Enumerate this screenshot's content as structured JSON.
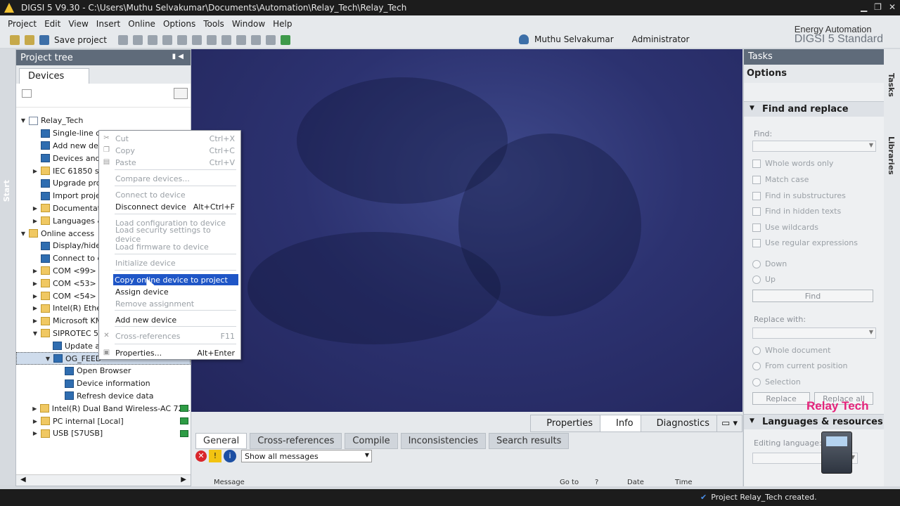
{
  "window": {
    "title": "DIGSI 5 V9.30  -  C:\\Users\\Muthu Selvakumar\\Documents\\Automation\\Relay_Tech\\Relay_Tech"
  },
  "menu": [
    "Project",
    "Edit",
    "View",
    "Insert",
    "Online",
    "Options",
    "Tools",
    "Window",
    "Help"
  ],
  "toolbar": {
    "save_label": "Save project"
  },
  "user": {
    "name": "Muthu Selvakumar",
    "role": "Administrator"
  },
  "brand": {
    "line1": "Energy Automation",
    "line2": "DIGSI 5 Standard"
  },
  "start_tab": "Start",
  "project_tree": {
    "title": "Project tree",
    "tab": "Devices",
    "rows": [
      {
        "label": "Relay_Tech",
        "arrow": "▼",
        "icon": "doc"
      },
      {
        "label": "Single-line co",
        "arrow": "",
        "icon": "blue"
      },
      {
        "label": "Add new dev",
        "arrow": "",
        "icon": "blue"
      },
      {
        "label": "Devices and",
        "arrow": "",
        "icon": "blue"
      },
      {
        "label": "IEC 61850 st",
        "arrow": "▶",
        "icon": "folder"
      },
      {
        "label": "Upgrade pro",
        "arrow": "",
        "icon": "blue"
      },
      {
        "label": "Import proje",
        "arrow": "",
        "icon": "blue"
      },
      {
        "label": "Documentat",
        "arrow": "▶",
        "icon": "folder"
      },
      {
        "label": "Languages &",
        "arrow": "▶",
        "icon": "folder"
      },
      {
        "label": "Online access",
        "arrow": "▼",
        "icon": "folder"
      },
      {
        "label": "Display/hide",
        "arrow": "",
        "icon": "blue"
      },
      {
        "label": "Connect to d",
        "arrow": "",
        "icon": "blue"
      },
      {
        "label": "COM <99>",
        "arrow": "▶",
        "icon": "folder"
      },
      {
        "label": "COM <53>",
        "arrow": "▶",
        "icon": "folder"
      },
      {
        "label": "COM <54>",
        "arrow": "▶",
        "icon": "folder"
      },
      {
        "label": "Intel(R) Ether",
        "arrow": "▶",
        "icon": "folder"
      },
      {
        "label": "Microsoft KM",
        "arrow": "▶",
        "icon": "folder"
      },
      {
        "label": "SIPROTEC 5 d",
        "arrow": "▼",
        "icon": "folder"
      },
      {
        "label": "Update a",
        "arrow": "",
        "icon": "blue"
      },
      {
        "label": "OG_FEED",
        "arrow": "▼",
        "icon": "blue"
      },
      {
        "label": "Open Browser",
        "arrow": "",
        "icon": "blue"
      },
      {
        "label": "Device information",
        "arrow": "",
        "icon": "blue"
      },
      {
        "label": "Refresh device data",
        "arrow": "",
        "icon": "blue"
      },
      {
        "label": "Intel(R) Dual Band Wireless-AC 72...",
        "arrow": "▶",
        "icon": "folder"
      },
      {
        "label": "PC internal [Local]",
        "arrow": "▶",
        "icon": "folder"
      },
      {
        "label": "USB [S7USB]",
        "arrow": "▶",
        "icon": "folder"
      }
    ]
  },
  "context_menu": {
    "items": [
      {
        "label": "Cut",
        "shortcut": "Ctrl+X",
        "disabled": true
      },
      {
        "label": "Copy",
        "shortcut": "Ctrl+C",
        "disabled": true
      },
      {
        "label": "Paste",
        "shortcut": "Ctrl+V",
        "disabled": true
      },
      {
        "label": "Compare devices...",
        "shortcut": "",
        "disabled": true
      },
      {
        "label": "Connect to device",
        "shortcut": "",
        "disabled": true
      },
      {
        "label": "Disconnect device",
        "shortcut": "Alt+Ctrl+F",
        "disabled": false
      },
      {
        "label": "Load configuration to device",
        "shortcut": "",
        "disabled": true
      },
      {
        "label": "Load security settings to device",
        "shortcut": "",
        "disabled": true
      },
      {
        "label": "Load firmware to device",
        "shortcut": "",
        "disabled": true
      },
      {
        "label": "Initialize device",
        "shortcut": "",
        "disabled": true
      },
      {
        "label": "Copy online device to project",
        "shortcut": "",
        "disabled": false,
        "highlighted": true
      },
      {
        "label": "Assign device",
        "shortcut": "",
        "disabled": false
      },
      {
        "label": "Remove assignment",
        "shortcut": "",
        "disabled": true
      },
      {
        "label": "Add new device",
        "shortcut": "",
        "disabled": false
      },
      {
        "label": "Cross-references",
        "shortcut": "F11",
        "disabled": true
      },
      {
        "label": "Properties...",
        "shortcut": "Alt+Enter",
        "disabled": false
      }
    ]
  },
  "inspector": {
    "tabs": [
      "Properties",
      "Info",
      "Diagnostics"
    ],
    "active_tab": "Info",
    "subtabs": [
      "General",
      "Cross-references",
      "Compile",
      "Inconsistencies",
      "Search results"
    ],
    "filter_value": "Show all messages",
    "columns": [
      "Message",
      "Go to",
      "?",
      "Date",
      "Time"
    ]
  },
  "tasks": {
    "title": "Tasks",
    "options_label": "Options",
    "find_replace_title": "Find and replace",
    "find_label": "Find:",
    "checkboxes": [
      "Whole words only",
      "Match case",
      "Find in substructures",
      "Find in hidden texts",
      "Use wildcards",
      "Use regular expressions"
    ],
    "direction": [
      "Down",
      "Up"
    ],
    "find_button": "Find",
    "replace_with_label": "Replace with:",
    "scope": [
      "Whole document",
      "From current position",
      "Selection"
    ],
    "replace_button": "Replace",
    "replace_all_button": "Replace all",
    "languages_title": "Languages & resources",
    "editing_language_label": "Editing language:"
  },
  "side_tabs": [
    "Tasks",
    "Libraries"
  ],
  "watermark": "Relay Tech",
  "status": {
    "message": "Project Relay_Tech created."
  }
}
